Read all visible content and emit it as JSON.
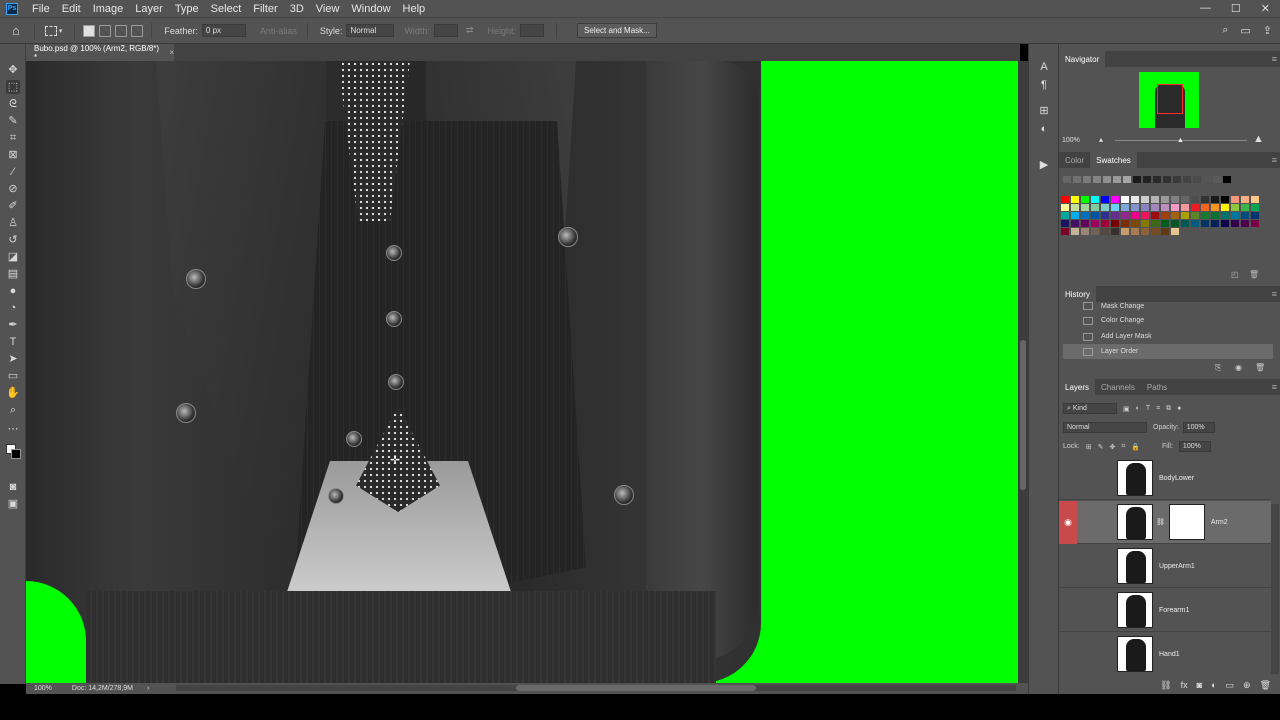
{
  "menubar": {
    "logo": "Ps",
    "items": [
      "File",
      "Edit",
      "Image",
      "Layer",
      "Type",
      "Select",
      "Filter",
      "3D",
      "View",
      "Window",
      "Help"
    ],
    "win_min": "—",
    "win_max": "☐",
    "win_close": "✕"
  },
  "options": {
    "feather_label": "Feather:",
    "feather_value": "0 px",
    "antialias_label": "Anti-alias",
    "style_label": "Style:",
    "style_value": "Normal",
    "width_label": "Width:",
    "height_label": "Height:",
    "select_mask": "Select and Mask..."
  },
  "document": {
    "tab_title": "Bubo.psd @ 100% (Arm2, RGB/8*) *",
    "close": "×"
  },
  "status": {
    "zoom": "100%",
    "doc": "Doc: 14,2M/278,9M",
    "arrow": "›"
  },
  "navigator": {
    "title": "Navigator",
    "zoom": "100%"
  },
  "color_panel": {
    "tabs": [
      "Color",
      "Swatches"
    ],
    "active": "Swatches",
    "swatch_colors": [
      "#ff0000",
      "#ffff00",
      "#00ff00",
      "#00ffff",
      "#0000ff",
      "#ff00ff",
      "#ffffff",
      "#e6e6e6",
      "#cccccc",
      "#b3b3b3",
      "#999999",
      "#808080",
      "#666666",
      "#4d4d4d",
      "#333333",
      "#1a1a1a",
      "#000000",
      "#f7977a",
      "#fbad82",
      "#fdc68c",
      "#fff79a",
      "#c4df9b",
      "#a3d39c",
      "#82ca9d",
      "#7bcdc8",
      "#6ecff6",
      "#7ea7d8",
      "#8493ca",
      "#8882be",
      "#a187be",
      "#bc8dbf",
      "#f49ac2",
      "#f6989d",
      "#ed1c24",
      "#f26522",
      "#f7941d",
      "#fff200",
      "#8dc63f",
      "#39b54a",
      "#00a651",
      "#00a99d",
      "#00aeef",
      "#0072bc",
      "#0054a6",
      "#2e3192",
      "#662d91",
      "#92278f",
      "#ec008c",
      "#ed145b",
      "#9e0b0f",
      "#a0410d",
      "#a36209",
      "#aba000",
      "#598527",
      "#197b30",
      "#007236",
      "#00746b",
      "#0076a3",
      "#004b80",
      "#003471",
      "#1b1464",
      "#440e62",
      "#630460",
      "#9e005d",
      "#9e0039",
      "#790000",
      "#7b2e00",
      "#7d4900",
      "#827b00",
      "#406618",
      "#005e20",
      "#005826",
      "#005952",
      "#005b7f",
      "#003663",
      "#002157",
      "#0d004c",
      "#32004b",
      "#4b0049",
      "#7b0046",
      "#7a0026",
      "#c7b299",
      "#998675",
      "#736357",
      "#534741",
      "#37302d",
      "#c69c6d",
      "#a67c52",
      "#8c6239",
      "#754c24",
      "#603913",
      "#e5c494"
    ]
  },
  "history": {
    "title": "History",
    "items": [
      "Mask Change",
      "Color Change",
      "Add Layer Mask",
      "Layer Order"
    ],
    "active_index": 3
  },
  "layers": {
    "tabs": [
      "Layers",
      "Channels",
      "Paths"
    ],
    "kind": "Kind",
    "blend": "Normal",
    "opacity_label": "Opacity:",
    "opacity": "100%",
    "lock_label": "Lock:",
    "fill_label": "Fill:",
    "fill": "100%",
    "items": [
      {
        "name": "BodyLower",
        "visible": false,
        "selected": false,
        "mask": false
      },
      {
        "name": "Arm2",
        "visible": true,
        "selected": true,
        "mask": true
      },
      {
        "name": "UpperArm1",
        "visible": false,
        "selected": false,
        "mask": false
      },
      {
        "name": "Forearm1",
        "visible": false,
        "selected": false,
        "mask": false
      },
      {
        "name": "Hand1",
        "visible": false,
        "selected": false,
        "mask": false
      }
    ]
  }
}
